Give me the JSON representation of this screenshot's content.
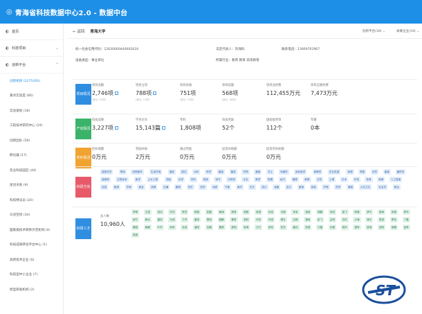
{
  "header": {
    "title": "青海省科技数据中心2.0 - 数据中台"
  },
  "sidebar": {
    "top": [
      {
        "label": "首页"
      },
      {
        "label": "科技项目"
      },
      {
        "label": "创新平台"
      }
    ],
    "subs": [
      "创新机构 (2275456)",
      "重点实验室 (66)",
      "实验基地 (18)",
      "工程技术研究中心 (24)",
      "创新团队 (59)",
      "孵化器 (17)",
      "农业科技园区 (44)",
      "星创天地 (9)",
      "科技特派员 (20)",
      "众创空间 (34)",
      "国家级技术转移示范机构 (4)",
      "科技成果转化平台中心 (1)",
      "高新技术企业 (6)",
      "科技型中小企业 (7)",
      "新型研发机构 (2)"
    ]
  },
  "crumb": {
    "back": "返回",
    "name": "青海大学",
    "sel1": "创新平台(18)",
    "sel2": "关联企业(18)"
  },
  "info": {
    "code_label": "统一社会信用代码",
    "code": "12630000440002024",
    "person_label": "法定代表人",
    "person": "刘海科",
    "phone_label": "联系电话",
    "phone": "13669761967",
    "type_label": "设备类型",
    "type": "事业单位",
    "field_label": "所属行业",
    "field": "教育 教育 高等教育"
  },
  "sections": [
    {
      "tag": "项目情况",
      "color": "#2f8ee0",
      "cells": [
        {
          "label": "项目总额",
          "value": "2,746项",
          "sub": "(参与: 91项)"
        },
        {
          "label": "项目立项",
          "value": "788项",
          "sub": "(参与: 71项)"
        },
        {
          "label": "项目验收",
          "value": "751项",
          "sub": "(参与: 71项)"
        },
        {
          "label": "项目结题",
          "value": "568项",
          "sub": "(参与: 48项)"
        },
        {
          "label": "项目总经费",
          "value": "112,455万元",
          "sub": ""
        },
        {
          "label": "项目自筹经费",
          "value": "7,473万元",
          "sub": ""
        }
      ]
    },
    {
      "tag": "产出情况",
      "color": "#3cb36a",
      "cells": [
        {
          "label": "科技成果",
          "value": "3,227项",
          "sub": ""
        },
        {
          "label": "学术论文",
          "value": "15,143篇",
          "sub": ""
        },
        {
          "label": "专利",
          "value": "1,808项",
          "sub": ""
        },
        {
          "label": "科技奖励",
          "value": "52个",
          "sub": ""
        },
        {
          "label": "国家级奖项",
          "value": "112个",
          "sub": ""
        },
        {
          "label": "专著",
          "value": "0本",
          "sub": ""
        }
      ]
    },
    {
      "tag": "奖补情况",
      "color": "#f0a330",
      "cells": [
        {
          "label": "后补助额",
          "value": "0万元",
          "sub": ""
        },
        {
          "label": "奖励补助",
          "value": "2万元",
          "sub": ""
        },
        {
          "label": "通过奖励",
          "value": "0万元",
          "sub": ""
        },
        {
          "label": "投资补助额",
          "value": "0万元",
          "sub": ""
        },
        {
          "label": "投资奖补助额",
          "value": "0万元",
          "sub": ""
        }
      ]
    }
  ],
  "research": {
    "tag": "科研方向",
    "chips": [
      "高原农学",
      "草地",
      "动物医学",
      "生态环境",
      "遥感",
      "园艺",
      "水利",
      "林学",
      "植保",
      "畜牧",
      "作物",
      "兽医",
      "冻土",
      "中藏药",
      "临床医学",
      "病理学",
      "农业机械",
      "地理",
      "草原",
      "农药",
      "畜禽",
      "藏药学",
      "高原病",
      "生物技术",
      "医学",
      "土木工程",
      "测绘",
      "化学",
      "材料",
      "机械",
      "电气",
      "计算机",
      "水文",
      "数学",
      "物理",
      "经济",
      "管理",
      "教育",
      "法学",
      "心理",
      "艺术",
      "外语",
      "体育",
      "新闻",
      "人工智能",
      "信息",
      "能源",
      "环境",
      "食品",
      "资源",
      "交通",
      "建筑",
      "历史",
      "哲学",
      "地质",
      "气象",
      "海洋",
      "天文",
      "统计",
      "金融",
      "会计",
      "营销",
      "旅游",
      "护理",
      "药学",
      "康复",
      "公共卫生",
      "社会学",
      "政治"
    ]
  },
  "talent": {
    "tag": "科研人才",
    "count_label": "总人数",
    "count": "10,960人",
    "chips": [
      "李明",
      "王强",
      "张伟",
      "刘洋",
      "陈杰",
      "杨帆",
      "赵磊",
      "黄涛",
      "周勇",
      "吴刚",
      "徐斌",
      "孙浩",
      "马超",
      "朱军",
      "胡波",
      "郭鹏",
      "何亮",
      "高飞",
      "林峰",
      "罗平",
      "梁辉",
      "宋健",
      "郑华",
      "谢宁",
      "韩冰",
      "唐亮",
      "冯涛",
      "于洋",
      "董军",
      "萧然",
      "程鹏",
      "曹勇",
      "袁林",
      "邓杰",
      "许强",
      "傅文",
      "沈刚",
      "曾辉",
      "彭飞",
      "吕明",
      "苏杰",
      "卢涛",
      "蒋平",
      "蔡斌",
      "贾伟",
      "丁磊",
      "魏强",
      "薛峰",
      "叶华",
      "阎军",
      "余波",
      "潘亮",
      "杜鹏",
      "戴勇",
      "夏明",
      "钟涛",
      "汪平",
      "田军",
      "任杰",
      "姜伟",
      "范强",
      "方磊",
      "石峰",
      "姚华",
      "谭军",
      "廖波",
      "邹亮",
      "熊鹏",
      "金勇",
      "陆明"
    ]
  }
}
